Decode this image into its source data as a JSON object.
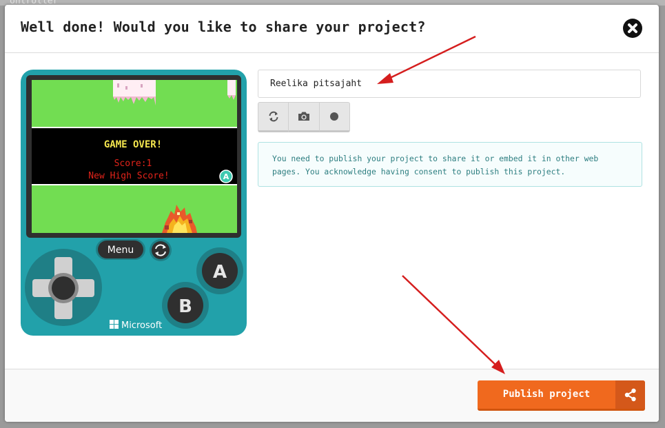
{
  "backdrop": {
    "text": "ontroller"
  },
  "dialog": {
    "title": "Well done! Would you like to share your project?",
    "close_icon": "close-icon"
  },
  "project": {
    "name_value": "Reelika pitsajaht"
  },
  "screenshot_buttons": [
    {
      "icon": "refresh-icon"
    },
    {
      "icon": "camera-icon"
    },
    {
      "icon": "record-icon"
    }
  ],
  "info": {
    "message": "You need to publish your project to share it or embed it in other web pages. You acknowledge having consent to publish this project."
  },
  "simulator": {
    "game_over": "GAME OVER!",
    "score": "Score:1",
    "high_score": "New High Score!",
    "a_badge": "A",
    "menu_label": "Menu",
    "button_a": "A",
    "button_b": "B",
    "brand": "Microsoft"
  },
  "footer": {
    "publish_label": "Publish project",
    "share_icon": "share-icon"
  },
  "colors": {
    "accent": "#f0691e",
    "device": "#22a1aa",
    "screen_green": "#72dd52",
    "info_text": "#2d7e80",
    "annotation_arrow": "#d51e1e"
  }
}
